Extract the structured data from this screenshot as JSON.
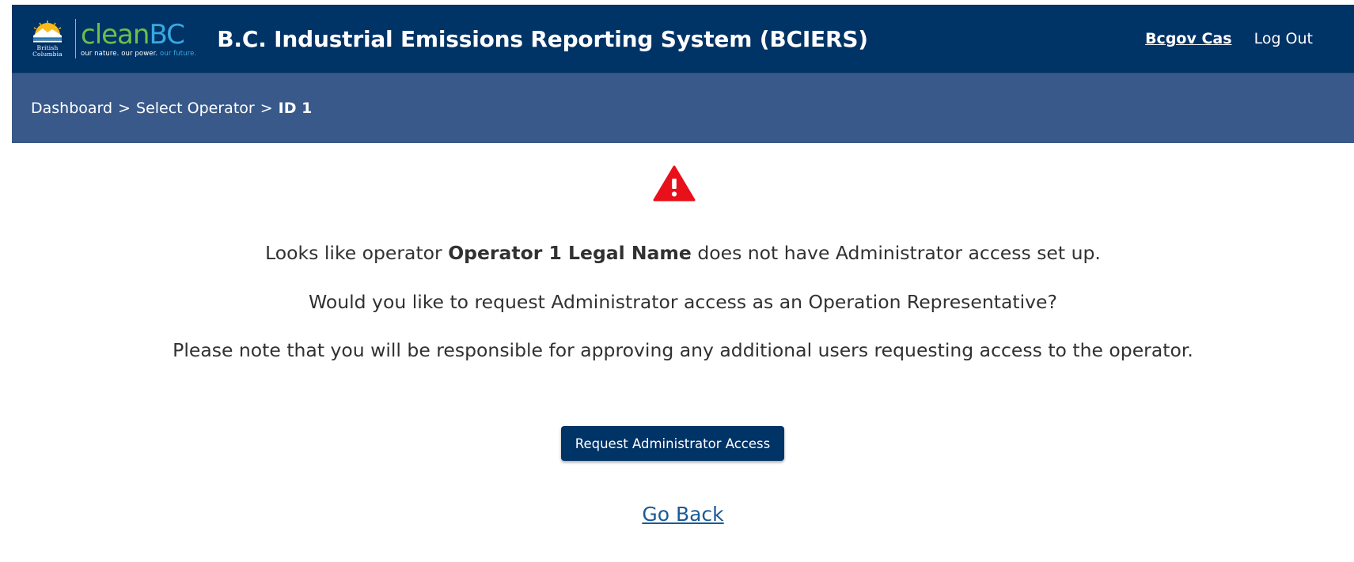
{
  "header": {
    "bc_logo_text_line1": "British",
    "bc_logo_text_line2": "Columbia",
    "cleanbc_part1": "clean",
    "cleanbc_part2": "BC",
    "cleanbc_tagline_part1": "our nature. our power. ",
    "cleanbc_tagline_part2": "our future.",
    "app_title": "B.C. Industrial Emissions Reporting System (BCIERS)",
    "user_name": "Bcgov Cas",
    "logout_label": "Log Out"
  },
  "breadcrumb": {
    "items": [
      "Dashboard",
      "Select Operator"
    ],
    "separator": ">",
    "current": "ID 1"
  },
  "main": {
    "icon": "warning-triangle-icon",
    "message1_prefix": "Looks like operator ",
    "message1_operator": "Operator 1 Legal Name",
    "message1_suffix": " does not have Administrator access set up.",
    "message2": "Would you like to request Administrator access as an Operation Representative?",
    "message3": "Please note that you will be responsible for approving any additional users requesting access to the operator.",
    "request_button_label": "Request Administrator Access",
    "go_back_label": "Go Back"
  },
  "colors": {
    "header_bg": "#003366",
    "breadcrumb_bg": "#38598a",
    "warning_red": "#e8101a",
    "link_blue": "#1a5a96",
    "cleanbc_green": "#6cc04a",
    "cleanbc_blue": "#38a9e0"
  }
}
